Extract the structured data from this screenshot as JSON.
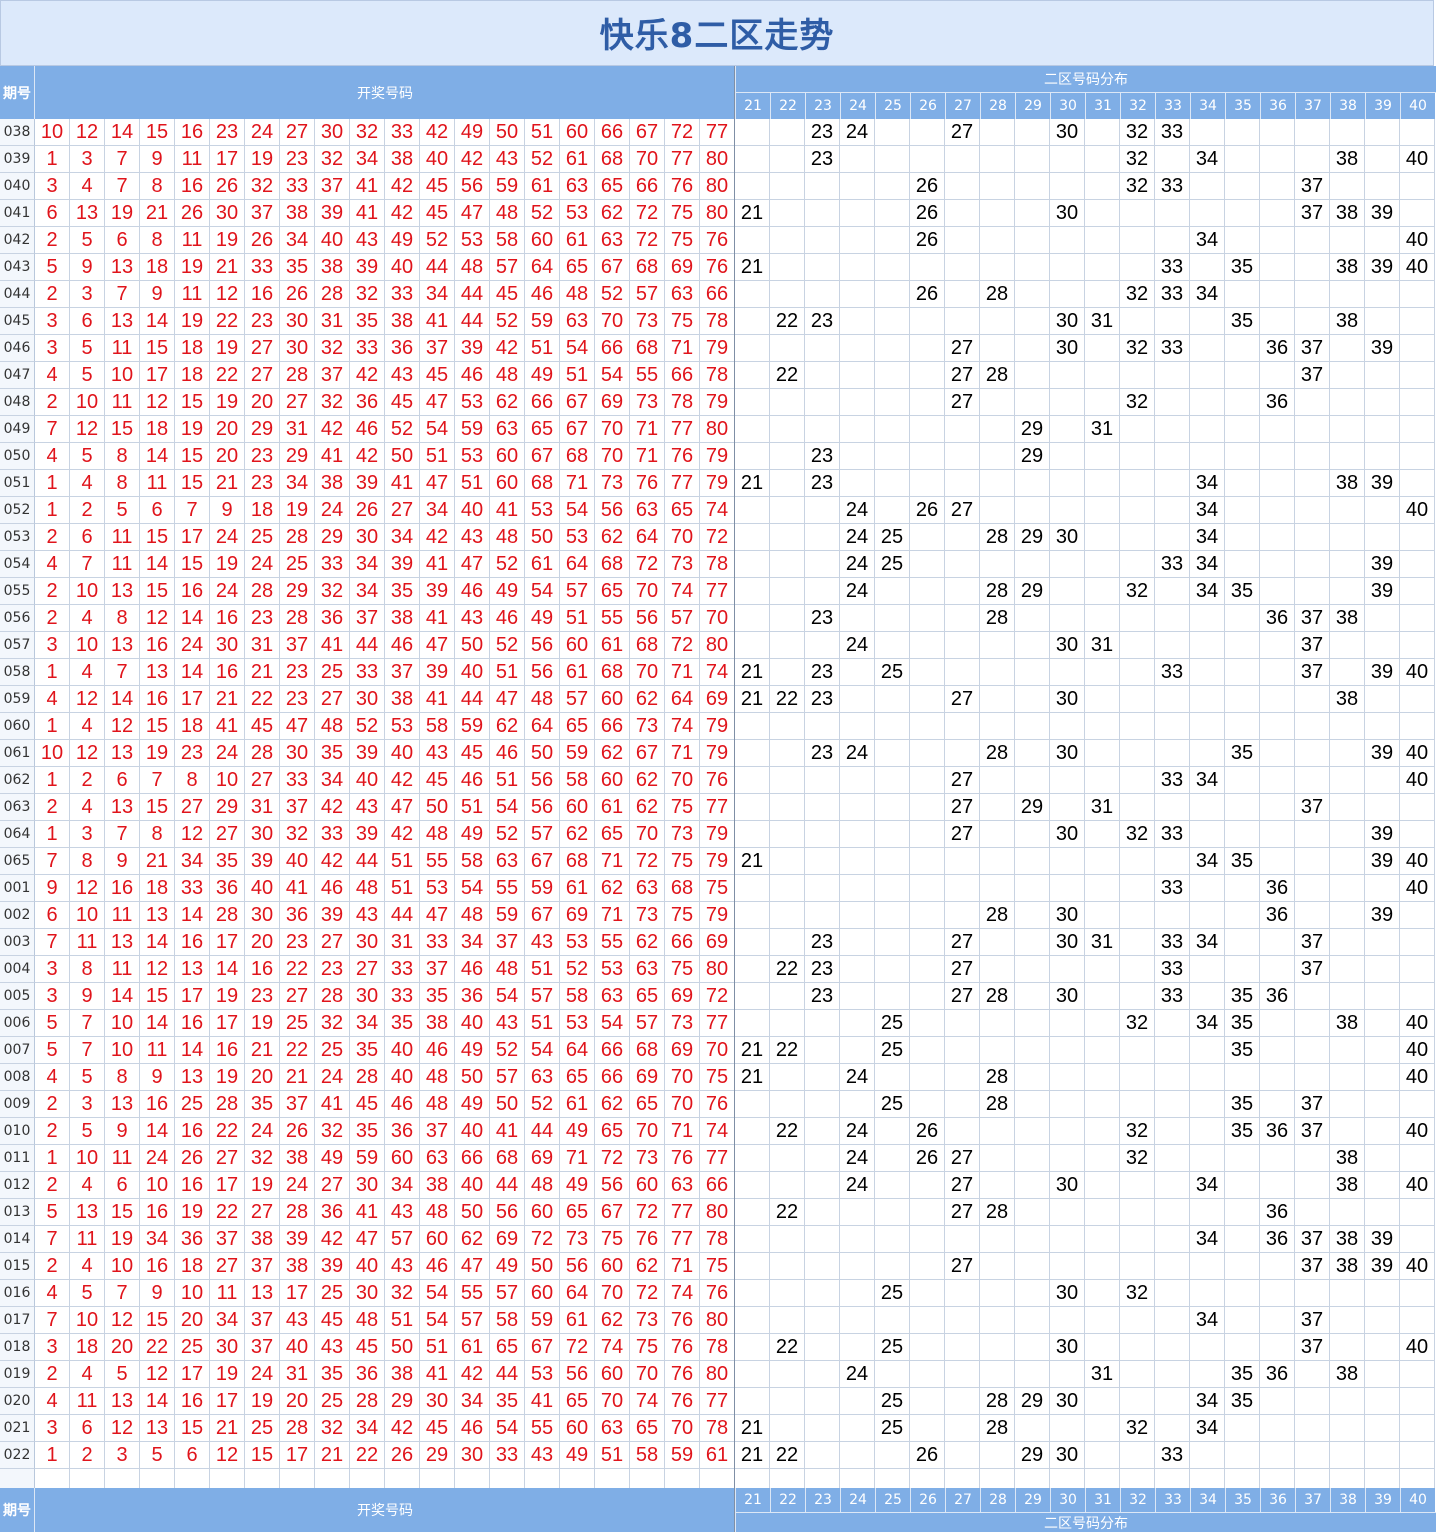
{
  "title": "快乐8二区走势",
  "header": {
    "issue_label": "期号",
    "draw_label": "开奖号码",
    "dist_label": "二区号码分布",
    "zone_numbers": [
      "21",
      "22",
      "23",
      "24",
      "25",
      "26",
      "27",
      "28",
      "29",
      "30",
      "31",
      "32",
      "33",
      "34",
      "35",
      "36",
      "37",
      "38",
      "39",
      "40"
    ]
  },
  "chart_data": {
    "type": "table",
    "zone_range": [
      21,
      40
    ],
    "rows": [
      {
        "issue": "038",
        "draw": [
          10,
          12,
          14,
          15,
          16,
          23,
          24,
          27,
          30,
          32,
          33,
          42,
          49,
          50,
          51,
          60,
          66,
          67,
          72,
          77
        ]
      },
      {
        "issue": "039",
        "draw": [
          1,
          3,
          7,
          9,
          11,
          17,
          19,
          23,
          32,
          34,
          38,
          40,
          42,
          43,
          52,
          61,
          68,
          70,
          77,
          80
        ]
      },
      {
        "issue": "040",
        "draw": [
          3,
          4,
          7,
          8,
          16,
          26,
          32,
          33,
          37,
          41,
          42,
          45,
          56,
          59,
          61,
          63,
          65,
          66,
          76,
          80
        ]
      },
      {
        "issue": "041",
        "draw": [
          6,
          13,
          19,
          21,
          26,
          30,
          37,
          38,
          39,
          41,
          42,
          45,
          47,
          48,
          52,
          53,
          62,
          72,
          75,
          80
        ]
      },
      {
        "issue": "042",
        "draw": [
          2,
          5,
          6,
          8,
          11,
          19,
          26,
          34,
          40,
          43,
          49,
          52,
          53,
          58,
          60,
          61,
          63,
          72,
          75,
          76
        ]
      },
      {
        "issue": "043",
        "draw": [
          5,
          9,
          13,
          18,
          19,
          21,
          33,
          35,
          38,
          39,
          40,
          44,
          48,
          57,
          64,
          65,
          67,
          68,
          69,
          76
        ]
      },
      {
        "issue": "044",
        "draw": [
          2,
          3,
          7,
          9,
          11,
          12,
          16,
          26,
          28,
          32,
          33,
          34,
          44,
          45,
          46,
          48,
          52,
          57,
          63,
          66
        ]
      },
      {
        "issue": "045",
        "draw": [
          3,
          6,
          13,
          14,
          19,
          22,
          23,
          30,
          31,
          35,
          38,
          41,
          44,
          52,
          59,
          63,
          70,
          73,
          75,
          78
        ]
      },
      {
        "issue": "046",
        "draw": [
          3,
          5,
          11,
          15,
          18,
          19,
          27,
          30,
          32,
          33,
          36,
          37,
          39,
          42,
          51,
          54,
          66,
          68,
          71,
          79
        ]
      },
      {
        "issue": "047",
        "draw": [
          4,
          5,
          10,
          17,
          18,
          22,
          27,
          28,
          37,
          42,
          43,
          45,
          46,
          48,
          49,
          51,
          54,
          55,
          66,
          78
        ]
      },
      {
        "issue": "048",
        "draw": [
          2,
          10,
          11,
          12,
          15,
          19,
          20,
          27,
          32,
          36,
          45,
          47,
          53,
          62,
          66,
          67,
          69,
          73,
          78,
          79
        ]
      },
      {
        "issue": "049",
        "draw": [
          7,
          12,
          15,
          18,
          19,
          20,
          29,
          31,
          42,
          46,
          52,
          54,
          59,
          63,
          65,
          67,
          70,
          71,
          77,
          80
        ]
      },
      {
        "issue": "050",
        "draw": [
          4,
          5,
          8,
          14,
          15,
          20,
          23,
          29,
          41,
          42,
          50,
          51,
          53,
          60,
          67,
          68,
          70,
          71,
          76,
          79
        ]
      },
      {
        "issue": "051",
        "draw": [
          1,
          4,
          8,
          11,
          15,
          21,
          23,
          34,
          38,
          39,
          41,
          47,
          51,
          60,
          68,
          71,
          73,
          76,
          77,
          79
        ]
      },
      {
        "issue": "052",
        "draw": [
          1,
          2,
          5,
          6,
          7,
          9,
          18,
          19,
          24,
          26,
          27,
          34,
          40,
          41,
          53,
          54,
          56,
          63,
          65,
          74
        ]
      },
      {
        "issue": "053",
        "draw": [
          2,
          6,
          11,
          15,
          17,
          24,
          25,
          28,
          29,
          30,
          34,
          42,
          43,
          48,
          50,
          53,
          62,
          64,
          70,
          72
        ]
      },
      {
        "issue": "054",
        "draw": [
          4,
          7,
          11,
          14,
          15,
          19,
          24,
          25,
          33,
          34,
          39,
          41,
          47,
          52,
          61,
          64,
          68,
          72,
          73,
          78
        ]
      },
      {
        "issue": "055",
        "draw": [
          2,
          10,
          13,
          15,
          16,
          24,
          28,
          29,
          32,
          34,
          35,
          39,
          46,
          49,
          54,
          57,
          65,
          70,
          74,
          77
        ]
      },
      {
        "issue": "056",
        "draw": [
          2,
          4,
          8,
          12,
          14,
          16,
          23,
          28,
          36,
          37,
          38,
          41,
          43,
          46,
          49,
          51,
          55,
          56,
          57,
          70
        ]
      },
      {
        "issue": "057",
        "draw": [
          3,
          10,
          13,
          16,
          24,
          30,
          31,
          37,
          41,
          44,
          46,
          47,
          50,
          52,
          56,
          60,
          61,
          68,
          72,
          80
        ]
      },
      {
        "issue": "058",
        "draw": [
          1,
          4,
          7,
          13,
          14,
          16,
          21,
          23,
          25,
          33,
          37,
          39,
          40,
          51,
          56,
          61,
          68,
          70,
          71,
          74
        ]
      },
      {
        "issue": "059",
        "draw": [
          4,
          12,
          14,
          16,
          17,
          21,
          22,
          23,
          27,
          30,
          38,
          41,
          44,
          47,
          48,
          57,
          60,
          62,
          64,
          69
        ]
      },
      {
        "issue": "060",
        "draw": [
          1,
          4,
          12,
          15,
          18,
          41,
          45,
          47,
          48,
          52,
          53,
          58,
          59,
          62,
          64,
          65,
          66,
          73,
          74,
          79
        ]
      },
      {
        "issue": "061",
        "draw": [
          10,
          12,
          13,
          19,
          23,
          24,
          28,
          30,
          35,
          39,
          40,
          43,
          45,
          46,
          50,
          59,
          62,
          67,
          71,
          79
        ]
      },
      {
        "issue": "062",
        "draw": [
          1,
          2,
          6,
          7,
          8,
          10,
          27,
          33,
          34,
          40,
          42,
          45,
          46,
          51,
          56,
          58,
          60,
          62,
          70,
          76
        ]
      },
      {
        "issue": "063",
        "draw": [
          2,
          4,
          13,
          15,
          27,
          29,
          31,
          37,
          42,
          43,
          47,
          50,
          51,
          54,
          56,
          60,
          61,
          62,
          75,
          77
        ]
      },
      {
        "issue": "064",
        "draw": [
          1,
          3,
          7,
          8,
          12,
          27,
          30,
          32,
          33,
          39,
          42,
          48,
          49,
          52,
          57,
          62,
          65,
          70,
          73,
          79
        ]
      },
      {
        "issue": "065",
        "draw": [
          7,
          8,
          9,
          21,
          34,
          35,
          39,
          40,
          42,
          44,
          51,
          55,
          58,
          63,
          67,
          68,
          71,
          72,
          75,
          79
        ]
      },
      {
        "issue": "001",
        "draw": [
          9,
          12,
          16,
          18,
          33,
          36,
          40,
          41,
          46,
          48,
          51,
          53,
          54,
          55,
          59,
          61,
          62,
          63,
          68,
          75
        ]
      },
      {
        "issue": "002",
        "draw": [
          6,
          10,
          11,
          13,
          14,
          28,
          30,
          36,
          39,
          43,
          44,
          47,
          48,
          59,
          67,
          69,
          71,
          73,
          75,
          79
        ]
      },
      {
        "issue": "003",
        "draw": [
          7,
          11,
          13,
          14,
          16,
          17,
          20,
          23,
          27,
          30,
          31,
          33,
          34,
          37,
          43,
          53,
          55,
          62,
          66,
          69
        ]
      },
      {
        "issue": "004",
        "draw": [
          3,
          8,
          11,
          12,
          13,
          14,
          16,
          22,
          23,
          27,
          33,
          37,
          46,
          48,
          51,
          52,
          53,
          63,
          75,
          80
        ]
      },
      {
        "issue": "005",
        "draw": [
          3,
          9,
          14,
          15,
          17,
          19,
          23,
          27,
          28,
          30,
          33,
          35,
          36,
          54,
          57,
          58,
          63,
          65,
          69,
          72
        ]
      },
      {
        "issue": "006",
        "draw": [
          5,
          7,
          10,
          14,
          16,
          17,
          19,
          25,
          32,
          34,
          35,
          38,
          40,
          43,
          51,
          53,
          54,
          57,
          73,
          77
        ]
      },
      {
        "issue": "007",
        "draw": [
          5,
          7,
          10,
          11,
          14,
          16,
          21,
          22,
          25,
          35,
          40,
          46,
          49,
          52,
          54,
          64,
          66,
          68,
          69,
          70
        ]
      },
      {
        "issue": "008",
        "draw": [
          4,
          5,
          8,
          9,
          13,
          19,
          20,
          21,
          24,
          28,
          40,
          48,
          50,
          57,
          63,
          65,
          66,
          69,
          70,
          75
        ]
      },
      {
        "issue": "009",
        "draw": [
          2,
          3,
          13,
          16,
          25,
          28,
          35,
          37,
          41,
          45,
          46,
          48,
          49,
          50,
          52,
          61,
          62,
          65,
          70,
          76
        ]
      },
      {
        "issue": "010",
        "draw": [
          2,
          5,
          9,
          14,
          16,
          22,
          24,
          26,
          32,
          35,
          36,
          37,
          40,
          41,
          44,
          49,
          65,
          70,
          71,
          74
        ]
      },
      {
        "issue": "011",
        "draw": [
          1,
          10,
          11,
          24,
          26,
          27,
          32,
          38,
          49,
          59,
          60,
          63,
          66,
          68,
          69,
          71,
          72,
          73,
          76,
          77
        ]
      },
      {
        "issue": "012",
        "draw": [
          2,
          4,
          6,
          10,
          16,
          17,
          19,
          24,
          27,
          30,
          34,
          38,
          40,
          44,
          48,
          49,
          56,
          60,
          63,
          66
        ]
      },
      {
        "issue": "013",
        "draw": [
          5,
          13,
          15,
          16,
          19,
          22,
          27,
          28,
          36,
          41,
          43,
          48,
          50,
          56,
          60,
          65,
          67,
          72,
          77,
          80
        ]
      },
      {
        "issue": "014",
        "draw": [
          7,
          11,
          19,
          34,
          36,
          37,
          38,
          39,
          42,
          47,
          57,
          60,
          62,
          69,
          72,
          73,
          75,
          76,
          77,
          78
        ]
      },
      {
        "issue": "015",
        "draw": [
          2,
          4,
          10,
          16,
          18,
          27,
          37,
          38,
          39,
          40,
          43,
          46,
          47,
          49,
          50,
          56,
          60,
          62,
          71,
          75
        ]
      },
      {
        "issue": "016",
        "draw": [
          4,
          5,
          7,
          9,
          10,
          11,
          13,
          17,
          25,
          30,
          32,
          54,
          55,
          57,
          60,
          64,
          70,
          72,
          74,
          76
        ]
      },
      {
        "issue": "017",
        "draw": [
          7,
          10,
          12,
          15,
          20,
          34,
          37,
          43,
          45,
          48,
          51,
          54,
          57,
          58,
          59,
          61,
          62,
          73,
          76,
          80
        ]
      },
      {
        "issue": "018",
        "draw": [
          3,
          18,
          20,
          22,
          25,
          30,
          37,
          40,
          43,
          45,
          50,
          51,
          61,
          65,
          67,
          72,
          74,
          75,
          76,
          78
        ]
      },
      {
        "issue": "019",
        "draw": [
          2,
          4,
          5,
          12,
          17,
          19,
          24,
          31,
          35,
          36,
          38,
          41,
          42,
          44,
          53,
          56,
          60,
          70,
          76,
          80
        ]
      },
      {
        "issue": "020",
        "draw": [
          4,
          11,
          13,
          14,
          16,
          17,
          19,
          20,
          25,
          28,
          29,
          30,
          34,
          35,
          41,
          65,
          70,
          74,
          76,
          77
        ]
      },
      {
        "issue": "021",
        "draw": [
          3,
          6,
          12,
          13,
          15,
          21,
          25,
          28,
          32,
          34,
          42,
          45,
          46,
          54,
          55,
          60,
          63,
          65,
          70,
          78
        ]
      },
      {
        "issue": "022",
        "draw": [
          1,
          2,
          3,
          5,
          6,
          12,
          15,
          17,
          21,
          22,
          26,
          29,
          30,
          33,
          43,
          49,
          51,
          58,
          59,
          61
        ]
      }
    ]
  },
  "colors": {
    "title_bg": "#dce9fb",
    "title_text": "#2f5da6",
    "header_bg": "#7faee6",
    "draw_number": "#e0141b",
    "zone_number": "#000000",
    "grid_line": "#c8d3e2"
  }
}
